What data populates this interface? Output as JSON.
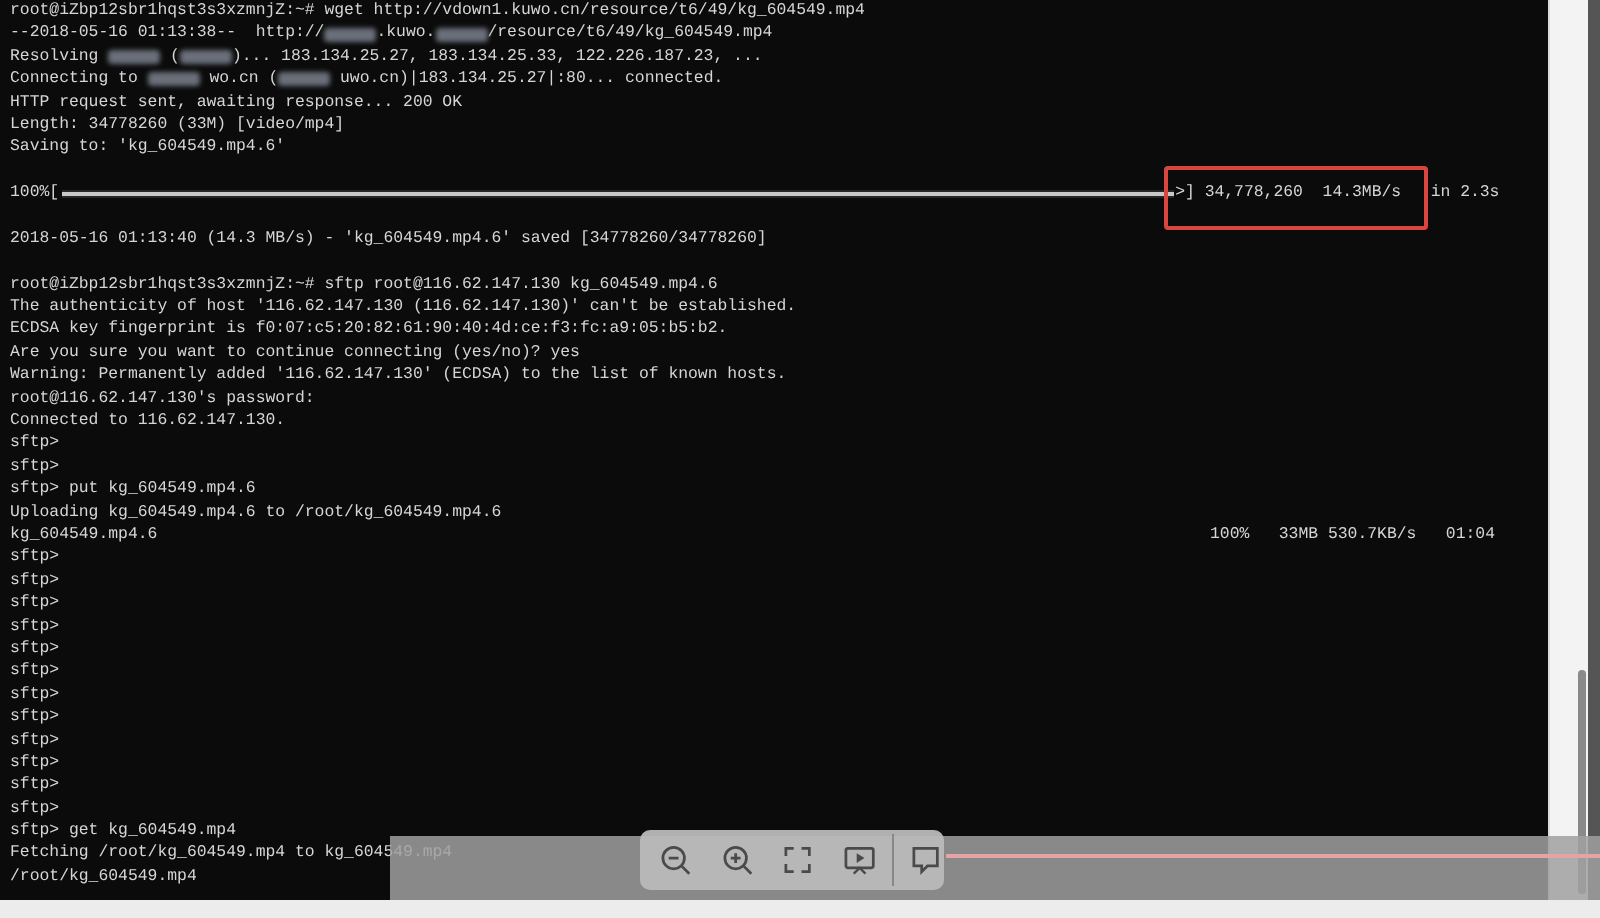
{
  "terminal": {
    "lines": [
      {
        "kind": "text",
        "text": "root@iZbp12sbr1hqst3s3xzmnjZ:~# wget http://vdown1.kuwo.cn/resource/t6/49/kg_604549.mp4"
      },
      {
        "kind": "parts",
        "parts": [
          {
            "kind": "text",
            "text": "--2018-05-16 01:13:38--  http://"
          },
          {
            "kind": "blur"
          },
          {
            "kind": "text",
            "text": ".kuwo."
          },
          {
            "kind": "blur"
          },
          {
            "kind": "text",
            "text": "/resource/t6/49/kg_604549.mp4"
          }
        ]
      },
      {
        "kind": "parts",
        "parts": [
          {
            "kind": "text",
            "text": "Resolving "
          },
          {
            "kind": "blur"
          },
          {
            "kind": "text",
            "text": " ("
          },
          {
            "kind": "blur"
          },
          {
            "kind": "text",
            "text": ")... 183.134.25.27, 183.134.25.33, 122.226.187.23, ..."
          }
        ]
      },
      {
        "kind": "parts",
        "parts": [
          {
            "kind": "text",
            "text": "Connecting to "
          },
          {
            "kind": "blur"
          },
          {
            "kind": "text",
            "text": " wo.cn ("
          },
          {
            "kind": "blur"
          },
          {
            "kind": "text",
            "text": " uwo.cn)|183.134.25.27|:80... connected."
          }
        ]
      },
      {
        "kind": "text",
        "text": "HTTP request sent, awaiting response... 200 OK"
      },
      {
        "kind": "text",
        "text": "Length: 34778260 (33M) [video/mp4]"
      },
      {
        "kind": "text",
        "text": "Saving to: 'kg_604549.mp4.6'"
      },
      {
        "kind": "blank"
      },
      {
        "kind": "progress",
        "percent": "100%[",
        "level": 1,
        "tail": ">] 34,778,260  14.3MB/s   in 2.3s",
        "highlighted": true
      },
      {
        "kind": "blank"
      },
      {
        "kind": "text",
        "text": "2018-05-16 01:13:40 (14.3 MB/s) - 'kg_604549.mp4.6' saved [34778260/34778260]"
      },
      {
        "kind": "blank"
      },
      {
        "kind": "text",
        "text": "root@iZbp12sbr1hqst3s3xzmnjZ:~# sftp root@116.62.147.130 kg_604549.mp4.6"
      },
      {
        "kind": "text",
        "text": "The authenticity of host '116.62.147.130 (116.62.147.130)' can't be established."
      },
      {
        "kind": "text",
        "text": "ECDSA key fingerprint is f0:07:c5:20:82:61:90:40:4d:ce:f3:fc:a9:05:b5:b2."
      },
      {
        "kind": "text",
        "text": "Are you sure you want to continue connecting (yes/no)? yes"
      },
      {
        "kind": "text",
        "text": "Warning: Permanently added '116.62.147.130' (ECDSA) to the list of known hosts."
      },
      {
        "kind": "text",
        "text": "root@116.62.147.130's password:"
      },
      {
        "kind": "text",
        "text": "Connected to 116.62.147.130."
      },
      {
        "kind": "text",
        "text": "sftp>"
      },
      {
        "kind": "text",
        "text": "sftp>"
      },
      {
        "kind": "text",
        "text": "sftp> put kg_604549.mp4.6"
      },
      {
        "kind": "text",
        "text": "Uploading kg_604549.mp4.6 to /root/kg_604549.mp4.6"
      },
      {
        "kind": "transfer",
        "file": "kg_604549.mp4.6",
        "stats": "100%   33MB 530.7KB/s   01:04"
      },
      {
        "kind": "text",
        "text": "sftp>"
      },
      {
        "kind": "text",
        "text": "sftp>"
      },
      {
        "kind": "text",
        "text": "sftp>"
      },
      {
        "kind": "text",
        "text": "sftp>"
      },
      {
        "kind": "text",
        "text": "sftp>"
      },
      {
        "kind": "text",
        "text": "sftp>"
      },
      {
        "kind": "text",
        "text": "sftp>"
      },
      {
        "kind": "text",
        "text": "sftp>"
      },
      {
        "kind": "text",
        "text": "sftp>"
      },
      {
        "kind": "text",
        "text": "sftp>"
      },
      {
        "kind": "text",
        "text": "sftp>"
      },
      {
        "kind": "text",
        "text": "sftp>"
      },
      {
        "kind": "text",
        "text": "sftp> get kg_604549.mp4"
      },
      {
        "kind": "text",
        "text": "Fetching /root/kg_604549.mp4 to kg_604549.mp4"
      },
      {
        "kind": "text",
        "text": "/root/kg_604549.mp4"
      }
    ]
  }
}
